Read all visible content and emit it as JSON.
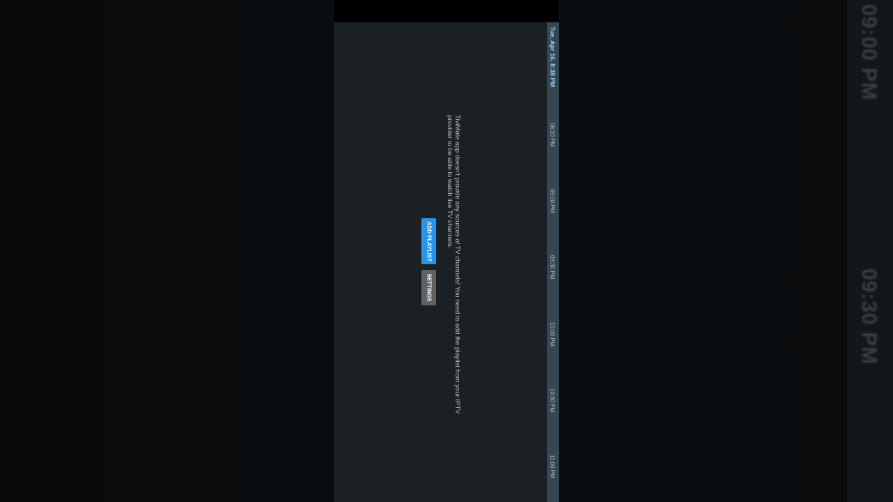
{
  "background": {
    "blurred_times": [
      "09:00 PM",
      "09:30 PM"
    ]
  },
  "header": {
    "date": "Tue, Apr 16, 8:38 PM"
  },
  "timeline": {
    "slots": [
      "08:30 PM",
      "09:00 PM",
      "09:30 PM",
      "10:00 PM",
      "10:30 PM",
      "11:00 PM"
    ]
  },
  "empty_state": {
    "message": "TiviMate app doesn't provide any sources of TV channels! You need to add the playlist from your IPTV provider to be able to watch live TV channels.",
    "add_playlist_label": "ADD PLAYLIST",
    "settings_label": "SETTINGS"
  },
  "colors": {
    "accent": "#2196f3",
    "secondary_button": "#616161",
    "rail": "#37474f",
    "screen_bg": "#1a2024"
  }
}
